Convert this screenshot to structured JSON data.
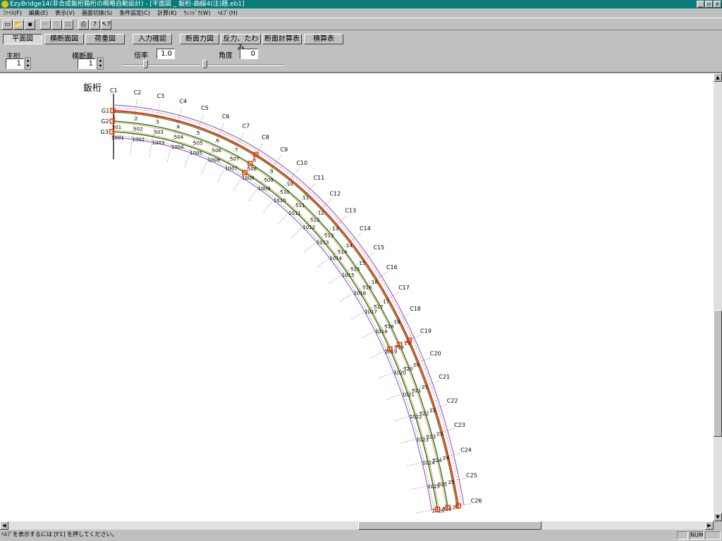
{
  "window": {
    "title": "EzyBridge14(非合成鈑桁箱桁の概略自動設計) - [平面図 _ 鈑桁-曲線4(注)題.eb1]",
    "min": "_",
    "max": "▫",
    "close": "x"
  },
  "menu": [
    "ﾌｧｲﾙ(F)",
    "編集(E)",
    "表示(V)",
    "画面切換(S)",
    "条件設定(C)",
    "計算(K)",
    "ｳｨﾝﾄﾞｳ(W)",
    "ﾍﾙﾌﾟ(H)"
  ],
  "toolbar": {
    "new": "▭",
    "open": "📂",
    "save": "▪",
    "cut": "✂",
    "copy": "⎘",
    "paste": "▤",
    "print": "⎙",
    "help": "?",
    "context_help": "↖?"
  },
  "view_buttons": [
    "平面図",
    "横断面図",
    "荷重図",
    "入力確認",
    "断面力図",
    "反力、たわみ",
    "断面計算表",
    "積算表"
  ],
  "controls": {
    "main_girder_label": "主桁",
    "main_girder_value": "1",
    "cross_section_label": "横断面",
    "cross_section_value": "1",
    "scale_label": "倍率",
    "scale_value": "1.0",
    "angle_label": "角度",
    "angle_value": "0",
    "scale_slider": 0.3,
    "angle_slider": 0.0
  },
  "drawing": {
    "title": "鈑桁",
    "girders": [
      "G1",
      "G2",
      "G3"
    ],
    "sections": [
      "C1",
      "C2",
      "C3",
      "C4",
      "C5",
      "C6",
      "C7",
      "C8",
      "C9",
      "C10",
      "C11",
      "C12",
      "C13",
      "C14",
      "C15",
      "C16",
      "C17",
      "C18",
      "C19",
      "C20",
      "C21",
      "C22",
      "C23",
      "C24",
      "C25",
      "C26"
    ],
    "node_base": [
      0,
      500,
      1000
    ],
    "colors": {
      "g1": "#ff2000",
      "girder": "#208020",
      "outline": "#a060c0",
      "deck": "#ff9040",
      "support": "#ff3000"
    }
  },
  "scroll": {
    "up": "▲",
    "down": "▼",
    "left": "◀",
    "right": "▶"
  },
  "status": {
    "text": "ﾍﾙﾌﾟを表示するには [F1] を押してください。",
    "num": "NUM"
  }
}
